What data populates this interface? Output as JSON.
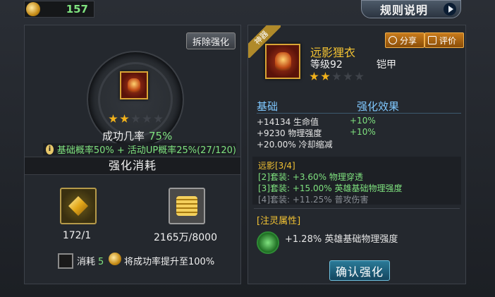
{
  "topbar": {
    "currency_icon": "gold-coin-icon",
    "currency_value": "157",
    "rules_button": "规则说明",
    "rules_arrow_icon": "play-arrow-icon"
  },
  "left": {
    "remove_button": "拆除强化",
    "stars_filled": 2,
    "stars_total": 5,
    "success_label": "成功几率",
    "success_pct": "75%",
    "info_icon": "i",
    "probability_text": "基础概率50% + 活动UP概率25%(27/120)",
    "cost_heading": "强化消耗",
    "materials": [
      {
        "icon": "enhance-stone-icon",
        "value": "172/1"
      },
      {
        "icon": "gold-pile-icon",
        "value": "2165万/8000"
      }
    ],
    "consume_label": "消耗",
    "consume_count": "5",
    "boost_text": "将成功率提升至100%"
  },
  "right": {
    "badge": "神器",
    "item_icon": "armor-icon",
    "item_name": "远影狸衣",
    "item_level": "等级92",
    "item_type": "铠甲",
    "stars_filled": 2,
    "stars_total": 5,
    "share_button": "分享",
    "eval_button": "评价",
    "stat_header_base": "基础",
    "stat_header_effect": "强化效果",
    "stats": [
      {
        "label": "+14134 生命值",
        "effect": "+10%"
      },
      {
        "label": "+9230 物理强度",
        "effect": "+10%"
      },
      {
        "label": "+20.00% 冷却缩减",
        "effect": ""
      }
    ],
    "set_title": "远影[3/4]",
    "set_lines": [
      {
        "text": "[2]套装: +3.60% 物理穿透",
        "active": true
      },
      {
        "text": "[3]套装: +15.00% 英雄基础物理强度",
        "active": true
      },
      {
        "text": "[4]套装: +11.25% 普攻伤害",
        "active": false
      }
    ],
    "spirit_title": "[注灵属性]",
    "spirit_icon": "spirit-orb-icon",
    "spirit_text": "+1.28% 英雄基础物理强度",
    "confirm_button": "确认强化"
  },
  "colors": {
    "accent_green": "#7fe27f",
    "accent_gold": "#f2c233",
    "accent_blue": "#7fc8ff"
  }
}
